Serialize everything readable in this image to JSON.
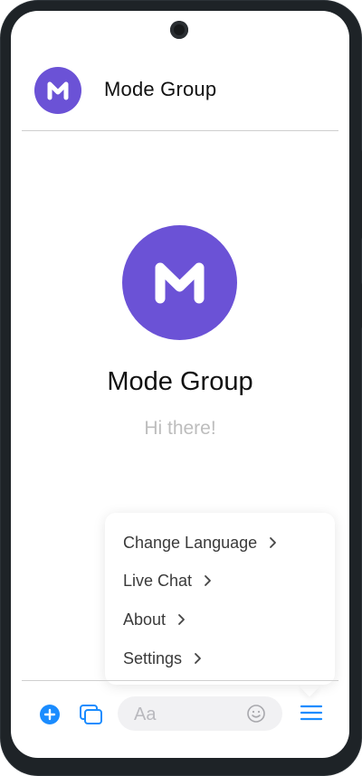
{
  "header": {
    "title": "Mode Group",
    "avatar_letter": "M"
  },
  "hero": {
    "title": "Mode Group",
    "greeting": "Hi there!"
  },
  "menu": {
    "items": [
      {
        "label": "Change Language"
      },
      {
        "label": "Live Chat"
      },
      {
        "label": "About"
      },
      {
        "label": "Settings"
      }
    ]
  },
  "composer": {
    "placeholder": "Aa",
    "icons": [
      "plus-icon",
      "gallery-icon",
      "emoji-icon",
      "menu-icon"
    ]
  },
  "colors": {
    "brand": "#6b52d6",
    "accent": "#1a8cff",
    "device_frame": "#1e2327"
  }
}
